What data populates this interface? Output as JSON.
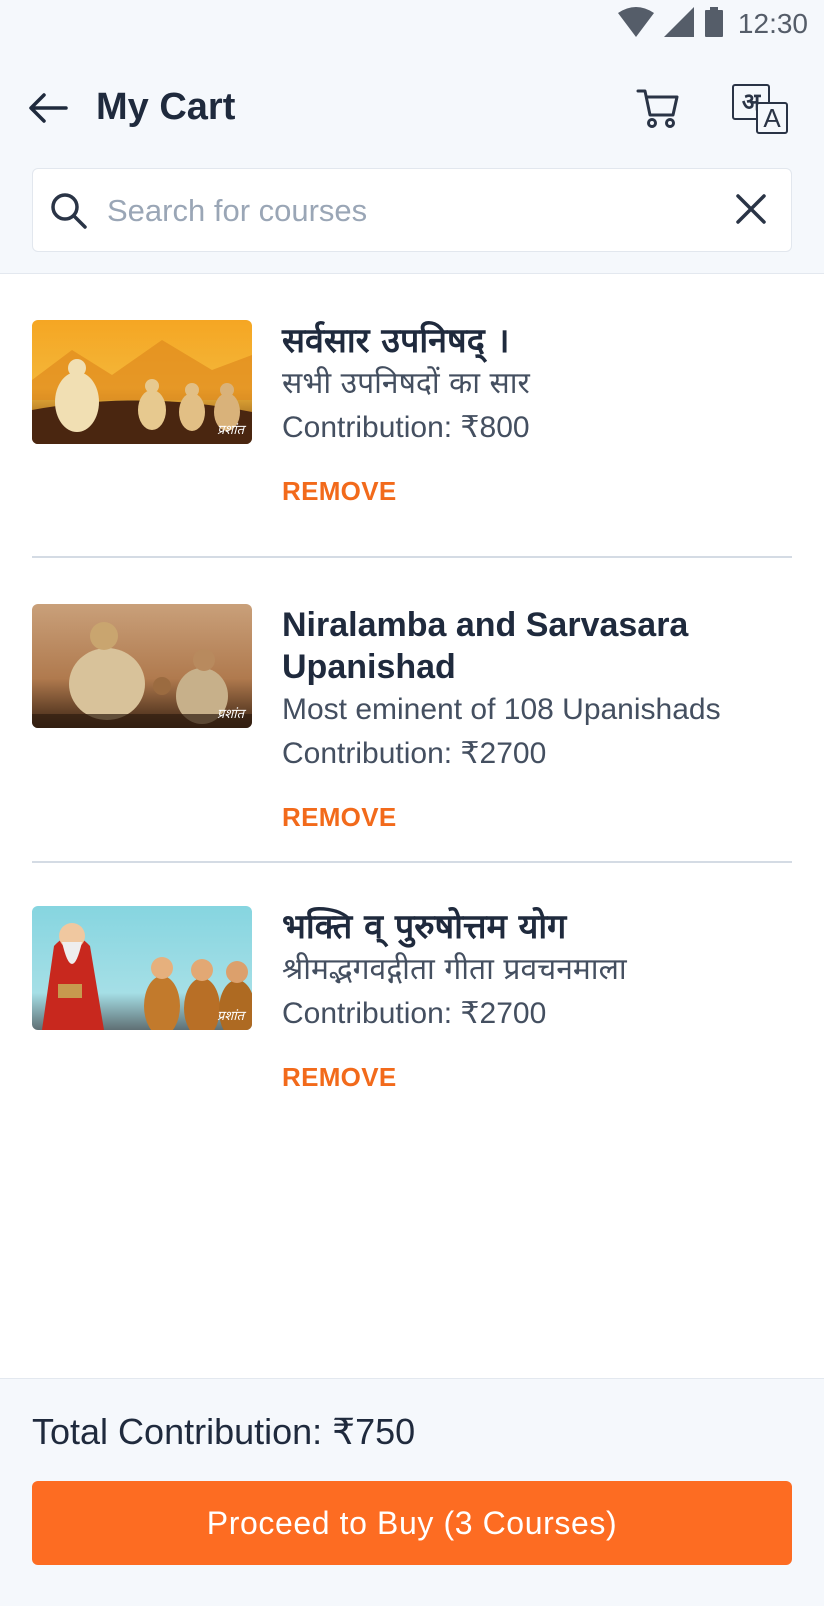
{
  "status_bar": {
    "time": "12:30",
    "icons": [
      "wifi-icon",
      "signal-icon",
      "battery-icon"
    ]
  },
  "header": {
    "title": "My Cart",
    "back_icon": "arrow-left-icon",
    "cart_icon": "cart-icon",
    "language_icon": "language-icon",
    "language_glyph_hindi": "अ",
    "language_glyph_latin": "A"
  },
  "search": {
    "placeholder": "Search for courses",
    "value": "",
    "clear_icon": "close-icon"
  },
  "cart": {
    "items": [
      {
        "title": "सर्वसार उपनिषद् ।",
        "subtitle": "सभी उपनिषदों का सार",
        "contribution": "Contribution: ₹800",
        "remove_label": "REMOVE",
        "thumbnail_watermark": "प्रशांत"
      },
      {
        "title": "Niralamba and Sarvasara Upanishad",
        "subtitle": "Most eminent of 108 Upanishads",
        "contribution": "Contribution: ₹2700",
        "remove_label": "REMOVE",
        "thumbnail_watermark": "प्रशांत"
      },
      {
        "title": "भक्ति व् पुरुषोत्तम योग",
        "subtitle": "श्रीमद्भगवद्गीता गीता प्रवचनमाला",
        "contribution": "Contribution: ₹2700",
        "remove_label": "REMOVE",
        "thumbnail_watermark": "प्रशांत"
      }
    ]
  },
  "footer": {
    "total": "Total Contribution: ₹750",
    "buy_label": "Proceed to Buy (3 Courses)"
  },
  "colors": {
    "accent": "#fd6c22",
    "remove": "#f26a1b",
    "text_primary": "#1f2a3d",
    "header_bg": "#f5f8fc"
  }
}
